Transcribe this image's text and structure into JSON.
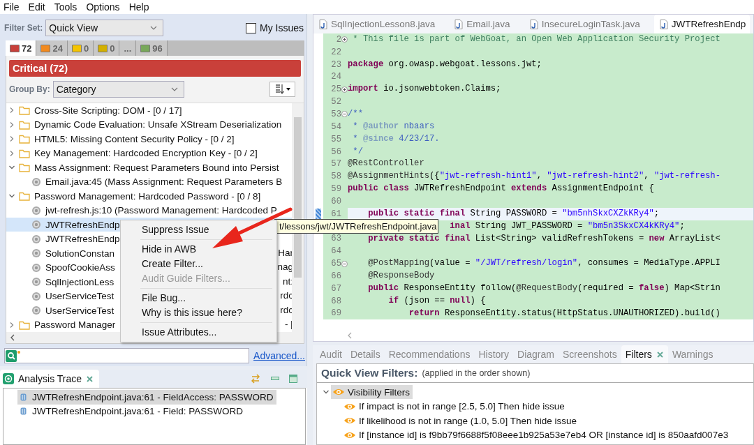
{
  "menu_bar": [
    "File",
    "Edit",
    "Tools",
    "Options",
    "Help"
  ],
  "filter_set": {
    "label": "Filter Set:",
    "value": "Quick View"
  },
  "my_issues": {
    "label": "My Issues",
    "checked": false
  },
  "severity_tabs": [
    {
      "count": "72",
      "color": "#c8403a",
      "selected": true
    },
    {
      "count": "24",
      "color": "#f28a1d",
      "selected": false
    },
    {
      "count": "0",
      "color": "#f5c400",
      "selected": false
    },
    {
      "count": "0",
      "color": "#d3b000",
      "selected": false
    },
    {
      "count": "...",
      "selected": false
    },
    {
      "count": "96",
      "color": "#78a85a",
      "selected": false
    }
  ],
  "severity_header": "Critical (72)",
  "group_by": {
    "label": "Group By:",
    "value": "Category"
  },
  "issue_tree": [
    {
      "kind": "folder",
      "text": "Cross-Site Scripting: DOM - [0 / 17]",
      "expanded": false,
      "selected": false
    },
    {
      "kind": "folder",
      "text": "Dynamic Code Evaluation: Unsafe XStream Deserialization",
      "expanded": false,
      "selected": false
    },
    {
      "kind": "folder",
      "text": "HTML5: Missing Content Security Policy - [0 / 2]",
      "expanded": false,
      "selected": false
    },
    {
      "kind": "folder",
      "text": "Key Management: Hardcoded Encryption Key - [0 / 2]",
      "expanded": false,
      "selected": false
    },
    {
      "kind": "folder",
      "text": "Mass Assignment: Request Parameters Bound into Persist",
      "expanded": true,
      "selected": false,
      "children": [
        {
          "kind": "issue",
          "text": "Email.java:45 (Mass Assignment: Request Parameters B",
          "selected": false
        }
      ]
    },
    {
      "kind": "folder",
      "text": "Password Management: Hardcoded Password - [0 / 8]",
      "expanded": true,
      "selected": false,
      "children": [
        {
          "kind": "issue",
          "text": "jwt-refresh.js:10 (Password Management: Hardcoded P",
          "selected": false
        },
        {
          "kind": "issue",
          "text": "JWTRefreshEndp",
          "selected": true
        },
        {
          "kind": "issue",
          "text": "JWTRefreshEndp",
          "selected": false
        },
        {
          "kind": "issue",
          "text": "SolutionConstan",
          "tail": "Har",
          "selected": false
        },
        {
          "kind": "issue",
          "text": "SpoofCookieAss",
          "tail": "nag",
          "selected": false
        },
        {
          "kind": "issue",
          "text": "SqlInjectionLess",
          "tail": "nt:",
          "selected": false
        },
        {
          "kind": "issue",
          "text": "UserServiceTest",
          "tail": "rdc",
          "selected": false
        },
        {
          "kind": "issue",
          "text": "UserServiceTest",
          "tail": "rdc",
          "selected": false
        }
      ]
    },
    {
      "kind": "folder",
      "text": "Password Manager",
      "tail": "- [",
      "expanded": false,
      "selected": false
    }
  ],
  "advanced_link": "Advanced...",
  "context_menu": [
    {
      "kind": "item",
      "label": "Suppress Issue",
      "disabled": false
    },
    {
      "kind": "separator"
    },
    {
      "kind": "item",
      "label": "Hide in AWB",
      "disabled": false
    },
    {
      "kind": "item",
      "label": "Create Filter...",
      "disabled": false
    },
    {
      "kind": "item",
      "label": "Audit Guide Filters...",
      "disabled": true
    },
    {
      "kind": "separator"
    },
    {
      "kind": "item",
      "label": "File Bug...",
      "disabled": false
    },
    {
      "kind": "item",
      "label": "Why is this issue here?",
      "disabled": false
    },
    {
      "kind": "separator"
    },
    {
      "kind": "item",
      "label": "Issue Attributes...",
      "disabled": false
    }
  ],
  "tooltip": "t/lessons/jwt/JWTRefreshEndpoint.java",
  "editor_tabs": [
    {
      "label": "SqlInjectionLesson8.java",
      "selected": false
    },
    {
      "label": "Email.java",
      "selected": false
    },
    {
      "label": "InsecureLoginTask.java",
      "selected": false
    },
    {
      "label": "JWTRefreshEndp",
      "selected": true
    }
  ],
  "code_lines": [
    {
      "num": "2",
      "expanded": false,
      "tokens": [
        {
          "kind": "comment",
          "text": " * This file is part of WebGoat, an Open Web Application Security Project"
        }
      ]
    },
    {
      "num": "22"
    },
    {
      "num": "23",
      "tokens": [
        {
          "kind": "keyword",
          "text": "package"
        },
        {
          "kind": "plain",
          "text": " org.owasp.webgoat.lessons.jwt;"
        }
      ]
    },
    {
      "num": "24"
    },
    {
      "num": "25",
      "expanded": false,
      "tokens": [
        {
          "kind": "keyword",
          "text": "import"
        },
        {
          "kind": "plain",
          "text": " io.jsonwebtoken.Claims;"
        }
      ]
    },
    {
      "num": "52"
    },
    {
      "num": "53",
      "expanded": true,
      "tokens": [
        {
          "kind": "doc",
          "text": "/**"
        }
      ]
    },
    {
      "num": "54",
      "tokens": [
        {
          "kind": "doc",
          "text": " * "
        },
        {
          "kind": "tag",
          "text": "@author"
        },
        {
          "kind": "doc",
          "text": " nbaars"
        }
      ]
    },
    {
      "num": "55",
      "tokens": [
        {
          "kind": "doc",
          "text": " * "
        },
        {
          "kind": "tag",
          "text": "@since"
        },
        {
          "kind": "doc",
          "text": " 4/23/17."
        }
      ]
    },
    {
      "num": "56",
      "tokens": [
        {
          "kind": "doc",
          "text": " */"
        }
      ]
    },
    {
      "num": "57",
      "tokens": [
        {
          "kind": "annotation",
          "text": "@RestController"
        }
      ]
    },
    {
      "num": "58",
      "tokens": [
        {
          "kind": "annotation",
          "text": "@AssignmentHints"
        },
        {
          "kind": "plain",
          "text": "({"
        },
        {
          "kind": "string",
          "text": "\"jwt-refresh-hint1\""
        },
        {
          "kind": "plain",
          "text": ", "
        },
        {
          "kind": "string",
          "text": "\"jwt-refresh-hint2\""
        },
        {
          "kind": "plain",
          "text": ", "
        },
        {
          "kind": "string",
          "text": "\"jwt-refresh-"
        }
      ]
    },
    {
      "num": "59",
      "tokens": [
        {
          "kind": "keyword",
          "text": "public class"
        },
        {
          "kind": "plain",
          "text": " JWTRefreshEndpoint "
        },
        {
          "kind": "keyword",
          "text": "extends"
        },
        {
          "kind": "plain",
          "text": " AssignmentEndpoint {"
        }
      ]
    },
    {
      "num": "60"
    },
    {
      "num": "61",
      "current": true,
      "marker": true,
      "tokens": [
        {
          "kind": "keyword",
          "text": "    public static final"
        },
        {
          "kind": "plain",
          "text": " String PASSWORD = "
        },
        {
          "kind": "string",
          "text": "\"bm5nhSkxCXZkKRy4\""
        },
        {
          "kind": "plain",
          "text": ";"
        }
      ]
    },
    {
      "covered_start": true,
      "tokens": [
        {
          "kind": "keyword",
          "text": "inal"
        },
        {
          "kind": "plain",
          "text": " String JWT_PASSWORD = "
        },
        {
          "kind": "string",
          "text": "\"bm5n3SkxCX4kKRy4\""
        },
        {
          "kind": "plain",
          "text": ";"
        }
      ]
    },
    {
      "num": "63",
      "tokens": [
        {
          "kind": "keyword",
          "text": "    private static final"
        },
        {
          "kind": "plain",
          "text": " List<String> validRefreshTokens = "
        },
        {
          "kind": "keyword",
          "text": "new"
        },
        {
          "kind": "plain",
          "text": " ArrayList<"
        }
      ]
    },
    {
      "num": "64"
    },
    {
      "num": "65",
      "expanded": true,
      "tokens": [
        {
          "kind": "annotation",
          "text": "    @PostMapping"
        },
        {
          "kind": "plain",
          "text": "(value = "
        },
        {
          "kind": "string",
          "text": "\"/JWT/refresh/login\""
        },
        {
          "kind": "plain",
          "text": ", consumes = MediaType.APPLI"
        }
      ]
    },
    {
      "num": "66",
      "tokens": [
        {
          "kind": "annotation",
          "text": "    @ResponseBody"
        }
      ]
    },
    {
      "num": "67",
      "tokens": [
        {
          "kind": "keyword",
          "text": "    public"
        },
        {
          "kind": "plain",
          "text": " ResponseEntity follow("
        },
        {
          "kind": "annotation",
          "text": "@RequestBody"
        },
        {
          "kind": "plain",
          "text": "(required = "
        },
        {
          "kind": "keyword",
          "text": "false"
        },
        {
          "kind": "plain",
          "text": ") Map<Strin"
        }
      ]
    },
    {
      "num": "68",
      "tokens": [
        {
          "kind": "keyword",
          "text": "        if"
        },
        {
          "kind": "plain",
          "text": " (json == "
        },
        {
          "kind": "keyword",
          "text": "null"
        },
        {
          "kind": "plain",
          "text": ") {"
        }
      ]
    },
    {
      "num": "69",
      "tokens": [
        {
          "kind": "keyword",
          "text": "            return"
        },
        {
          "kind": "plain",
          "text": " ResponseEntity.status(HttpStatus.UNAUTHORIZED).build()"
        }
      ]
    }
  ],
  "analysis_trace": {
    "title": "Analysis Trace",
    "rows": [
      {
        "text": "JWTRefreshEndpoint.java:61 - FieldAccess: PASSWORD",
        "selected": true
      },
      {
        "text": "JWTRefreshEndpoint.java:61 - Field: PASSWORD",
        "selected": false
      }
    ]
  },
  "bottom_tabs": [
    {
      "label": "Audit",
      "selected": false
    },
    {
      "label": "Details",
      "selected": false
    },
    {
      "label": "Recommendations",
      "selected": false
    },
    {
      "label": "History",
      "selected": false
    },
    {
      "label": "Diagram",
      "selected": false
    },
    {
      "label": "Screenshots",
      "selected": false
    },
    {
      "label": "Filters",
      "selected": true
    },
    {
      "label": "Warnings",
      "selected": false
    }
  ],
  "filters_panel": {
    "title": "Quick View Filters:",
    "note": "(applied in the order shown)",
    "tree": [
      {
        "text": "Visibility Filters",
        "expanded": true,
        "selected": true,
        "children": [
          {
            "text": "If impact is not in range [2.5, 5.0] Then hide issue",
            "selected": false
          },
          {
            "text": "If likelihood is not in range (1.0, 5.0] Then hide issue",
            "selected": false
          },
          {
            "text": "If [instance id] is f9bb79f6688f5f08eee1b925a53e7eb4 OR [instance id] is 850aafd007e3",
            "selected": false
          }
        ]
      }
    ]
  }
}
